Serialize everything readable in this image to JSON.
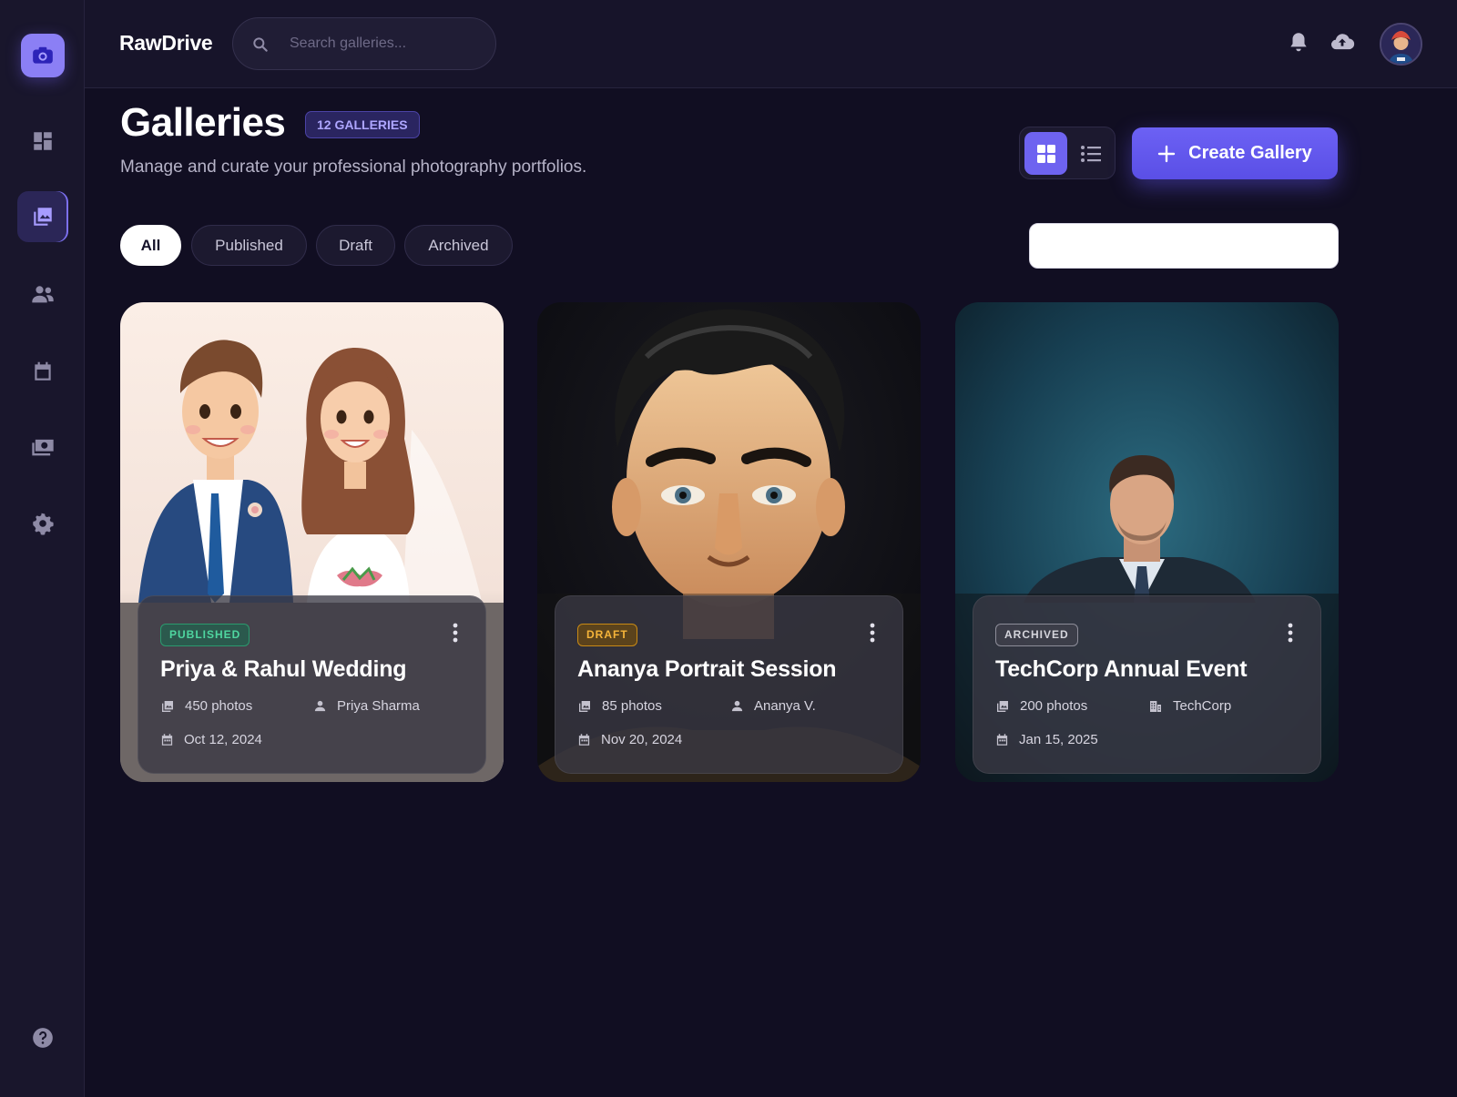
{
  "app": {
    "brand": "RawDrive"
  },
  "colors": {
    "accent": "#6c61f4",
    "background": "#110e22",
    "sidebar": "#19162c"
  },
  "header": {
    "search_placeholder": "Search galleries...",
    "icons": [
      "notification-bell-icon",
      "cloud-upload-icon",
      "user-avatar"
    ]
  },
  "sidebar": {
    "items": [
      {
        "icon": "dashboard-icon",
        "active": false
      },
      {
        "icon": "photo-library-icon",
        "active": true
      },
      {
        "icon": "clients-icon",
        "active": false
      },
      {
        "icon": "calendar-icon",
        "active": false
      },
      {
        "icon": "payments-icon",
        "active": false
      },
      {
        "icon": "settings-gear-icon",
        "active": false
      }
    ],
    "bottom_icon": "help-icon"
  },
  "page": {
    "title": "Galleries",
    "count_badge": "12 GALLERIES",
    "subtitle": "Manage and curate your professional photography portfolios.",
    "create_label": "Create Gallery",
    "view_mode": "grid"
  },
  "filters": [
    {
      "label": "All",
      "active": true
    },
    {
      "label": "Published",
      "active": false
    },
    {
      "label": "Draft",
      "active": false
    },
    {
      "label": "Archived",
      "active": false
    }
  ],
  "galleries": [
    {
      "status": "PUBLISHED",
      "title": "Priya & Rahul Wedding",
      "photos": "450 photos",
      "client": "Priya Sharma",
      "client_icon": "person-icon",
      "date": "Oct 12, 2024"
    },
    {
      "status": "DRAFT",
      "title": "Ananya Portrait Session",
      "photos": "85 photos",
      "client": "Ananya V.",
      "client_icon": "person-icon",
      "date": "Nov 20, 2024"
    },
    {
      "status": "ARCHIVED",
      "title": "TechCorp Annual Event",
      "photos": "200 photos",
      "client": "TechCorp",
      "client_icon": "building-icon",
      "date": "Jan 15, 2025"
    }
  ]
}
